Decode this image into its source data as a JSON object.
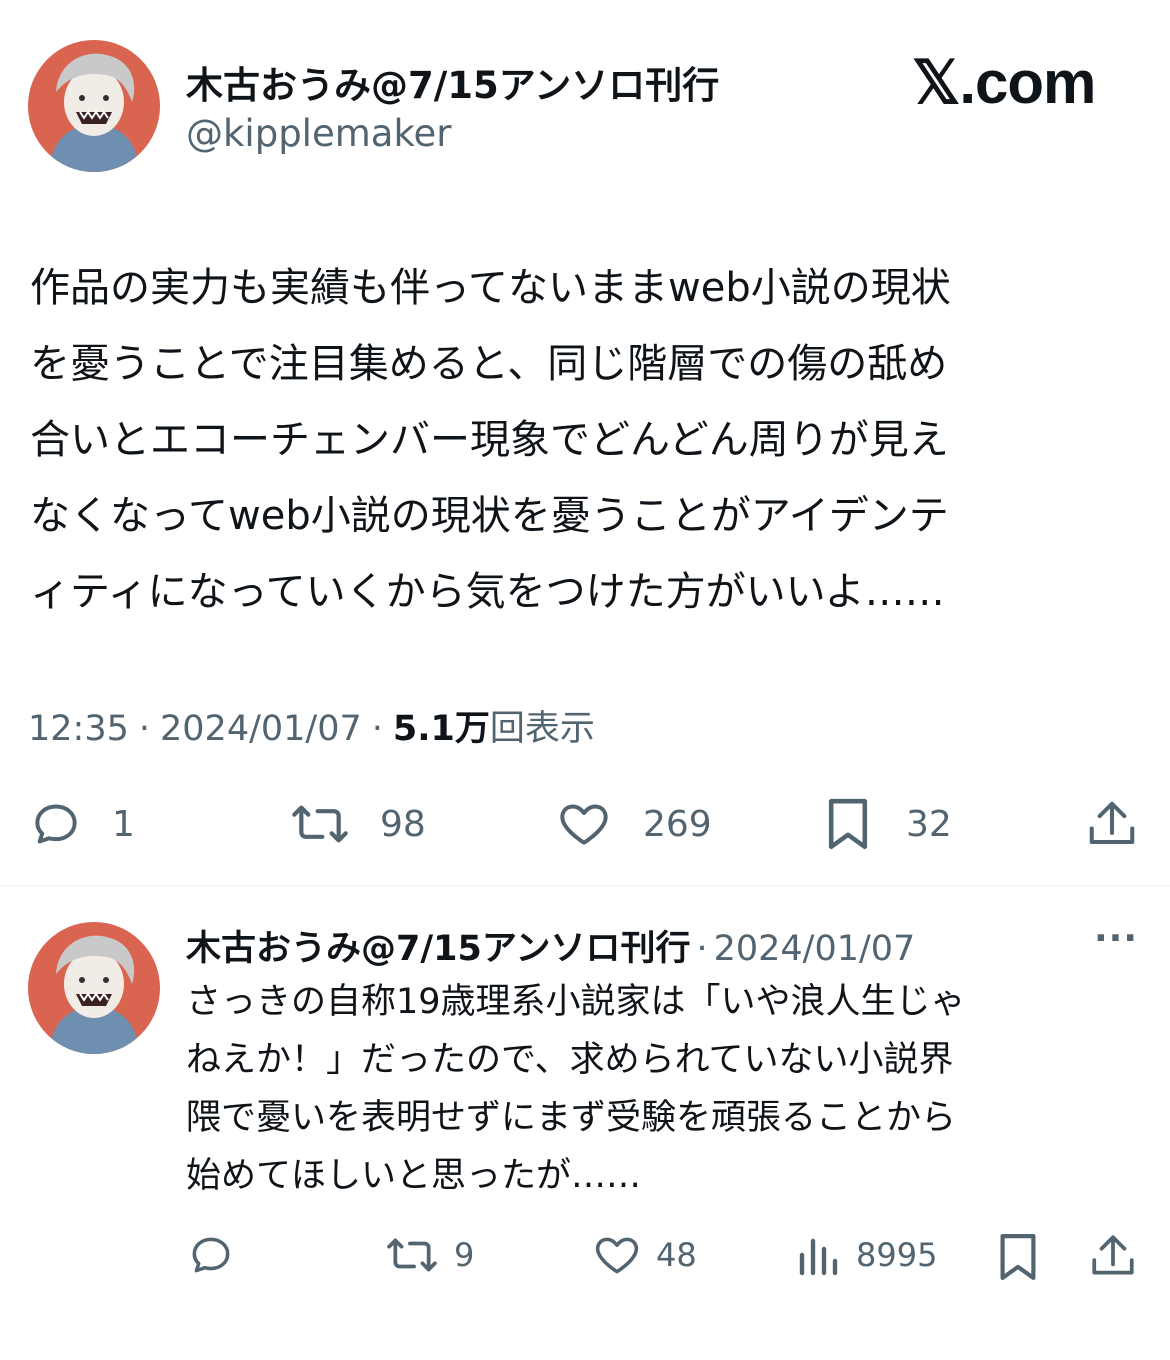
{
  "brand": "𝕏.com",
  "main_tweet": {
    "author_name": "木古おうみ@7/15アンソロ刊行",
    "author_handle": "@kipplemaker",
    "lines": [
      "作品の実力も実績も伴ってないままweb小説の現状",
      "を憂うことで注目集めると、同じ階層での傷の舐め",
      "合いとエコーチェンバー現象でどんどん周りが見え",
      "なくなってweb小説の現状を憂うことがアイデンテ",
      "ィティになっていくから気をつけた方がいいよ……"
    ],
    "time": "12:35",
    "date": "2024/01/07",
    "sep": "·",
    "views_count": "5.1万",
    "views_label": "回表示",
    "replies": "1",
    "retweets": "98",
    "likes": "269",
    "bookmarks": "32"
  },
  "reply_tweet": {
    "author_name": "木古おうみ@7/15アンソロ刊行",
    "sep": "·",
    "date": "2024/01/07",
    "more": "···",
    "lines": [
      "さっきの自称19歳理系小説家は「いや浪人生じゃ",
      "ねえか！」だったので、求められていない小説界",
      "隈で憂いを表明せずにまず受験を頑張ることから",
      "始めてほしいと思ったが……"
    ],
    "replies": "",
    "retweets": "9",
    "likes": "48",
    "views": "8995"
  },
  "colors": {
    "text": "#0f1419",
    "muted": "#536471",
    "divider": "#eff3f4",
    "avatar_bg": "#d9644f"
  }
}
